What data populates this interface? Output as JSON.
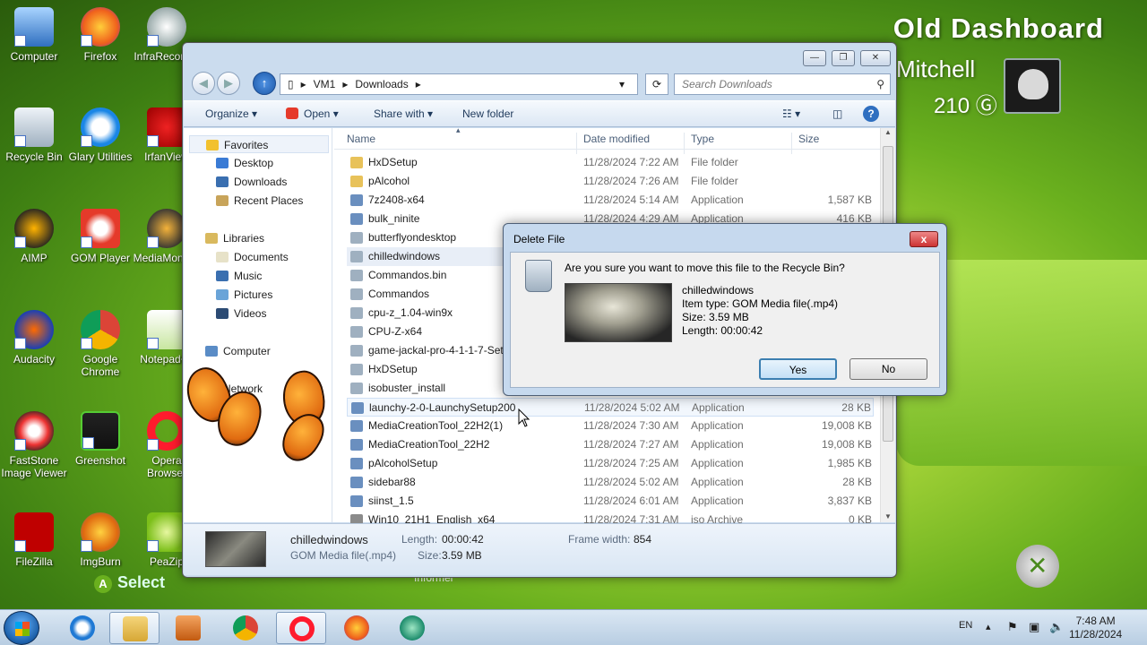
{
  "desktop": {
    "background_title": "Old Dashboard",
    "gamertag": "Mitchell",
    "gamerscore": "210",
    "select_label": "Select",
    "informer_label": "Informer",
    "icons": [
      {
        "label": "Computer"
      },
      {
        "label": "Firefox"
      },
      {
        "label": "InfraRecorder"
      },
      {
        "label": "Recycle Bin"
      },
      {
        "label": "Glary Utilities"
      },
      {
        "label": "IrfanView"
      },
      {
        "label": "AIMP"
      },
      {
        "label": "GOM Player"
      },
      {
        "label": "MediaMonkey"
      },
      {
        "label": "Audacity"
      },
      {
        "label": "Google Chrome"
      },
      {
        "label": "Notepad++"
      },
      {
        "label": "FastStone Image Viewer"
      },
      {
        "label": "Greenshot"
      },
      {
        "label": "Opera Browser"
      },
      {
        "label": "FileZilla"
      },
      {
        "label": "ImgBurn"
      },
      {
        "label": "PeaZip"
      }
    ]
  },
  "explorer": {
    "window_controls": {
      "minimize": "—",
      "maximize": "❐",
      "close": "✕"
    },
    "breadcrumb": [
      "VM1",
      "Downloads"
    ],
    "search_placeholder": "Search Downloads",
    "toolbar": {
      "organize": "Organize",
      "open": "Open",
      "share_with": "Share with",
      "new_folder": "New folder"
    },
    "nav": {
      "favorites": "Favorites",
      "desktop": "Desktop",
      "downloads": "Downloads",
      "recent_places": "Recent Places",
      "libraries": "Libraries",
      "documents": "Documents",
      "music": "Music",
      "pictures": "Pictures",
      "videos": "Videos",
      "computer": "Computer",
      "network": "Network"
    },
    "columns": {
      "name": "Name",
      "date": "Date modified",
      "type": "Type",
      "size": "Size"
    },
    "files": [
      {
        "name": "HxDSetup",
        "date": "11/28/2024 7:22 AM",
        "type": "File folder",
        "size": ""
      },
      {
        "name": "pAlcohol",
        "date": "11/28/2024 7:26 AM",
        "type": "File folder",
        "size": ""
      },
      {
        "name": "7z2408-x64",
        "date": "11/28/2024 5:14 AM",
        "type": "Application",
        "size": "1,587 KB"
      },
      {
        "name": "bulk_ninite",
        "date": "11/28/2024 4:29 AM",
        "type": "Application",
        "size": "416 KB"
      },
      {
        "name": "butterflyondesktop",
        "date": "",
        "type": "",
        "size": ""
      },
      {
        "name": "chilledwindows",
        "date": "",
        "type": "",
        "size": ""
      },
      {
        "name": "Commandos.bin",
        "date": "",
        "type": "",
        "size": ""
      },
      {
        "name": "Commandos",
        "date": "",
        "type": "",
        "size": ""
      },
      {
        "name": "cpu-z_1.04-win9x",
        "date": "",
        "type": "",
        "size": ""
      },
      {
        "name": "CPU-Z-x64",
        "date": "",
        "type": "",
        "size": ""
      },
      {
        "name": "game-jackal-pro-4-1-1-7-Set",
        "date": "",
        "type": "",
        "size": ""
      },
      {
        "name": "HxDSetup",
        "date": "",
        "type": "",
        "size": ""
      },
      {
        "name": "isobuster_install",
        "date": "",
        "type": "",
        "size": ""
      },
      {
        "name": "launchy-2-0-LaunchySetup200",
        "date": "11/28/2024 5:02 AM",
        "type": "Application",
        "size": "28 KB"
      },
      {
        "name": "MediaCreationTool_22H2(1)",
        "date": "11/28/2024 7:30 AM",
        "type": "Application",
        "size": "19,008 KB"
      },
      {
        "name": "MediaCreationTool_22H2",
        "date": "11/28/2024 7:27 AM",
        "type": "Application",
        "size": "19,008 KB"
      },
      {
        "name": "pAlcoholSetup",
        "date": "11/28/2024 7:25 AM",
        "type": "Application",
        "size": "1,985 KB"
      },
      {
        "name": "sidebar88",
        "date": "11/28/2024 5:02 AM",
        "type": "Application",
        "size": "28 KB"
      },
      {
        "name": "siinst_1.5",
        "date": "11/28/2024 6:01 AM",
        "type": "Application",
        "size": "3,837 KB"
      },
      {
        "name": "Win10_21H1_English_x64",
        "date": "11/28/2024 7:31 AM",
        "type": "iso Archive",
        "size": "0 KB"
      }
    ],
    "details": {
      "name": "chilledwindows",
      "type": "GOM Media file(.mp4)",
      "length_label": "Length:",
      "length_value": "00:00:42",
      "size_label": "Size:",
      "size_value": "3.59 MB",
      "frame_label": "Frame width:",
      "frame_value": "854"
    }
  },
  "dialog": {
    "title": "Delete File",
    "close": "x",
    "message": "Are you sure you want to move this file to the Recycle Bin?",
    "file_name": "chilledwindows",
    "item_type": "Item type: GOM Media file(.mp4)",
    "size": "Size: 3.59 MB",
    "length": "Length: 00:00:42",
    "yes": "Yes",
    "no": "No"
  },
  "taskbar": {
    "language": "EN",
    "time": "7:48 AM",
    "date": "11/28/2024"
  }
}
